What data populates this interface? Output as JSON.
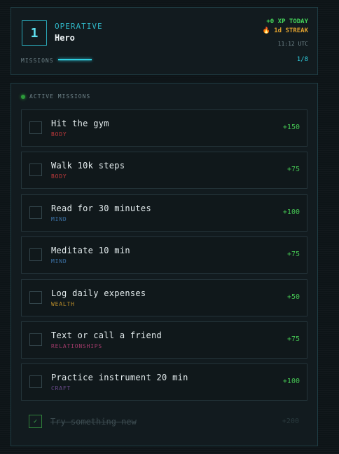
{
  "header": {
    "level": "1",
    "rank": "OPERATIVE",
    "name": "Hero",
    "xp_today": "+0 XP TODAY",
    "streak_icon": "fire-icon",
    "streak": "🔥 1d STREAK",
    "clock": "11:12 UTC",
    "missions_label": "MISSIONS",
    "progress_count": "1/8",
    "progress_fraction": 0.125
  },
  "colors": {
    "accent": "#30cfe0",
    "xp_green": "#45c653",
    "streak": "#e0a12e"
  },
  "active_label": "ACTIVE MISSIONS",
  "missions": [
    {
      "title": "Hit the gym",
      "category": "BODY",
      "category_color": "#c0393b",
      "xp": "+150"
    },
    {
      "title": "Walk 10k steps",
      "category": "BODY",
      "category_color": "#c0393b",
      "xp": "+75"
    },
    {
      "title": "Read for 30 minutes",
      "category": "MIND",
      "category_color": "#3d73a8",
      "xp": "+100"
    },
    {
      "title": "Meditate 10 min",
      "category": "MIND",
      "category_color": "#3d73a8",
      "xp": "+75"
    },
    {
      "title": "Log daily expenses",
      "category": "WEALTH",
      "category_color": "#b58a2a",
      "xp": "+50"
    },
    {
      "title": "Text or call a friend",
      "category": "RELATIONSHIPS",
      "category_color": "#a23a6a",
      "xp": "+75"
    },
    {
      "title": "Practice instrument 20 min",
      "category": "CRAFT",
      "category_color": "#6a4a8c",
      "xp": "+100"
    }
  ],
  "completed": {
    "title": "Try something new",
    "xp": "+200",
    "check": "✓"
  }
}
